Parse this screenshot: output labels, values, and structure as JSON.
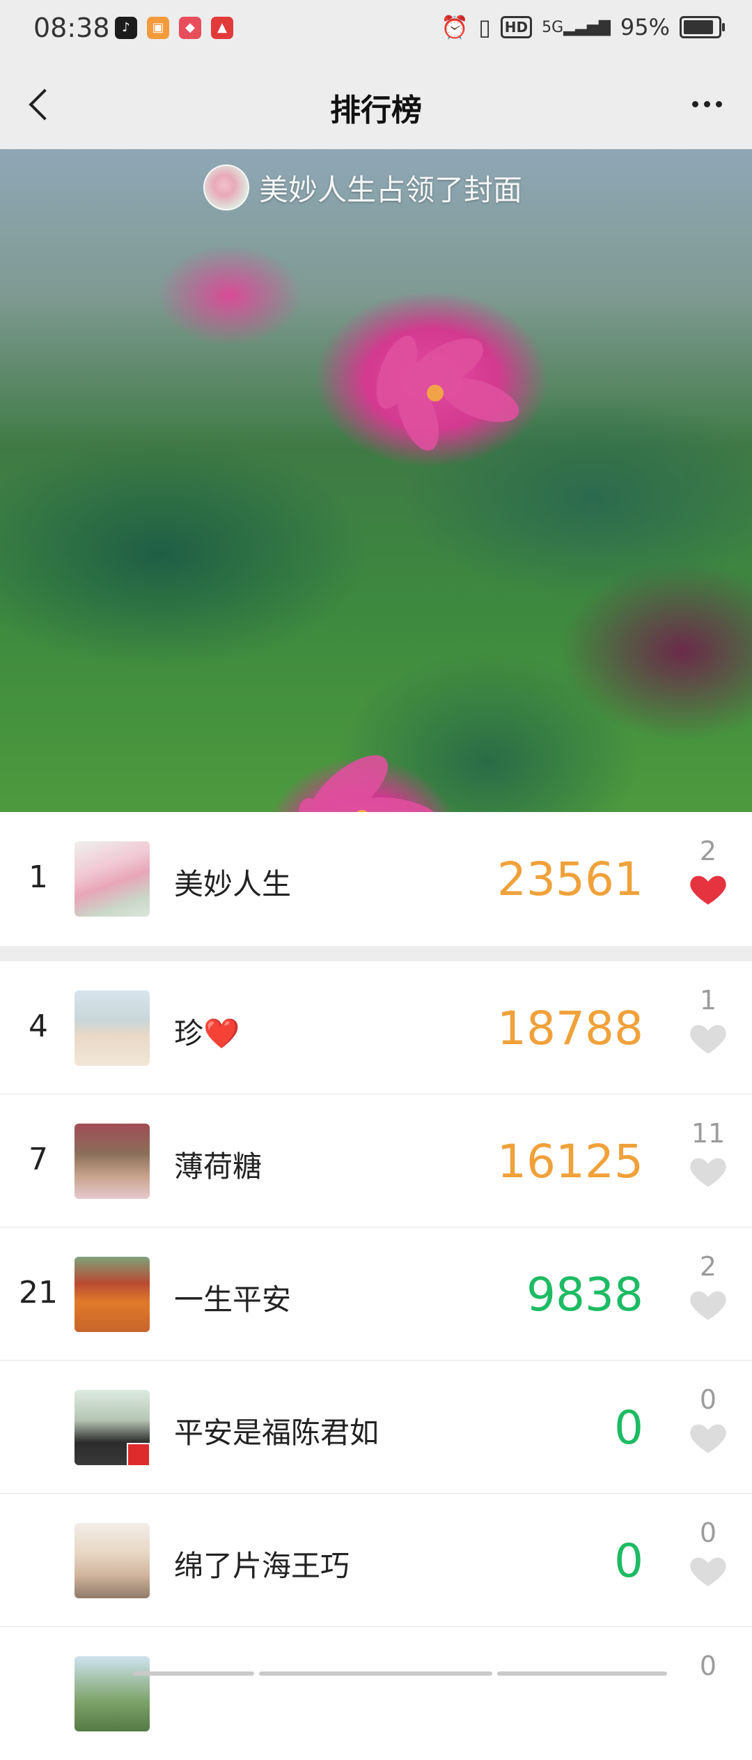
{
  "status_bar": {
    "time": "08:38",
    "notifications": [
      "tiktok-icon",
      "app-icon-1",
      "app-icon-2",
      "app-icon-3"
    ],
    "network": "5G",
    "hd": "HD",
    "battery_percent": "95%",
    "battery_level": 0.95
  },
  "nav": {
    "title": "排行榜"
  },
  "cover": {
    "caption": "美妙人生占领了封面"
  },
  "colors": {
    "steps_orange": "#f0a13a",
    "steps_green": "#1dbb63",
    "heart_red": "#e53340",
    "heart_gray": "#d9d9d9"
  },
  "my_rank": {
    "rank": "1",
    "name": "美妙人生",
    "steps": "23561",
    "likes": "2",
    "liked": true
  },
  "rankings": [
    {
      "rank": "4",
      "name": "珍",
      "name_emoji": "❤️",
      "steps": "18788",
      "likes": "1",
      "liked": false
    },
    {
      "rank": "7",
      "name": "薄荷糖",
      "steps": "16125",
      "likes": "11",
      "liked": false
    },
    {
      "rank": "21",
      "name": "一生平安",
      "steps": "9838",
      "likes": "2",
      "liked": false
    },
    {
      "rank": "",
      "name": "平安是福陈君如",
      "steps": "0",
      "likes": "0",
      "liked": false
    },
    {
      "rank": "",
      "name": "绵了片海王巧",
      "steps": "0",
      "likes": "0",
      "liked": false
    },
    {
      "rank": "",
      "name": "",
      "steps": "",
      "likes": "0",
      "liked": false
    }
  ]
}
